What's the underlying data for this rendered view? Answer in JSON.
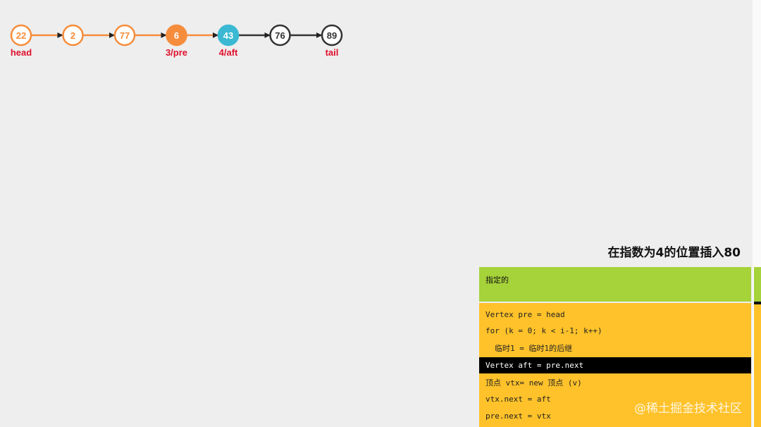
{
  "linked_list": {
    "nodes": [
      {
        "value": "22",
        "state": "visited",
        "label": "head"
      },
      {
        "value": "2",
        "state": "visited",
        "label": ""
      },
      {
        "value": "77",
        "state": "visited",
        "label": ""
      },
      {
        "value": "6",
        "state": "current",
        "label": "3/pre"
      },
      {
        "value": "43",
        "state": "next",
        "label": "4/aft"
      },
      {
        "value": "76",
        "state": "default",
        "label": ""
      },
      {
        "value": "89",
        "state": "default",
        "label": "tail"
      }
    ],
    "edges": [
      {
        "state": "visited"
      },
      {
        "state": "visited"
      },
      {
        "state": "visited"
      },
      {
        "state": "visited"
      },
      {
        "state": "default"
      },
      {
        "state": "default"
      }
    ],
    "colors": {
      "visited": "#f58d3c",
      "current": "#f58d3c",
      "next": "#3bb9d3",
      "default": "#333333",
      "label": "#e0102c"
    }
  },
  "panel": {
    "title": "在指数为4的位置插入80",
    "status": "指定的",
    "code_lines": [
      "Vertex pre = head",
      "for (k = 0; k < i-1; k++)",
      "临时1 = 临时1的后继",
      "Vertex aft = pre.next",
      "顶点 vtx= new 顶点 (v)",
      "vtx.next = aft",
      "pre.next = vtx"
    ],
    "active_line": 3,
    "colors": {
      "status_bg": "#a6d23a",
      "code_bg": "#ffc22a",
      "active_bg": "#000000"
    }
  },
  "watermark": "@稀土掘金技术社区"
}
